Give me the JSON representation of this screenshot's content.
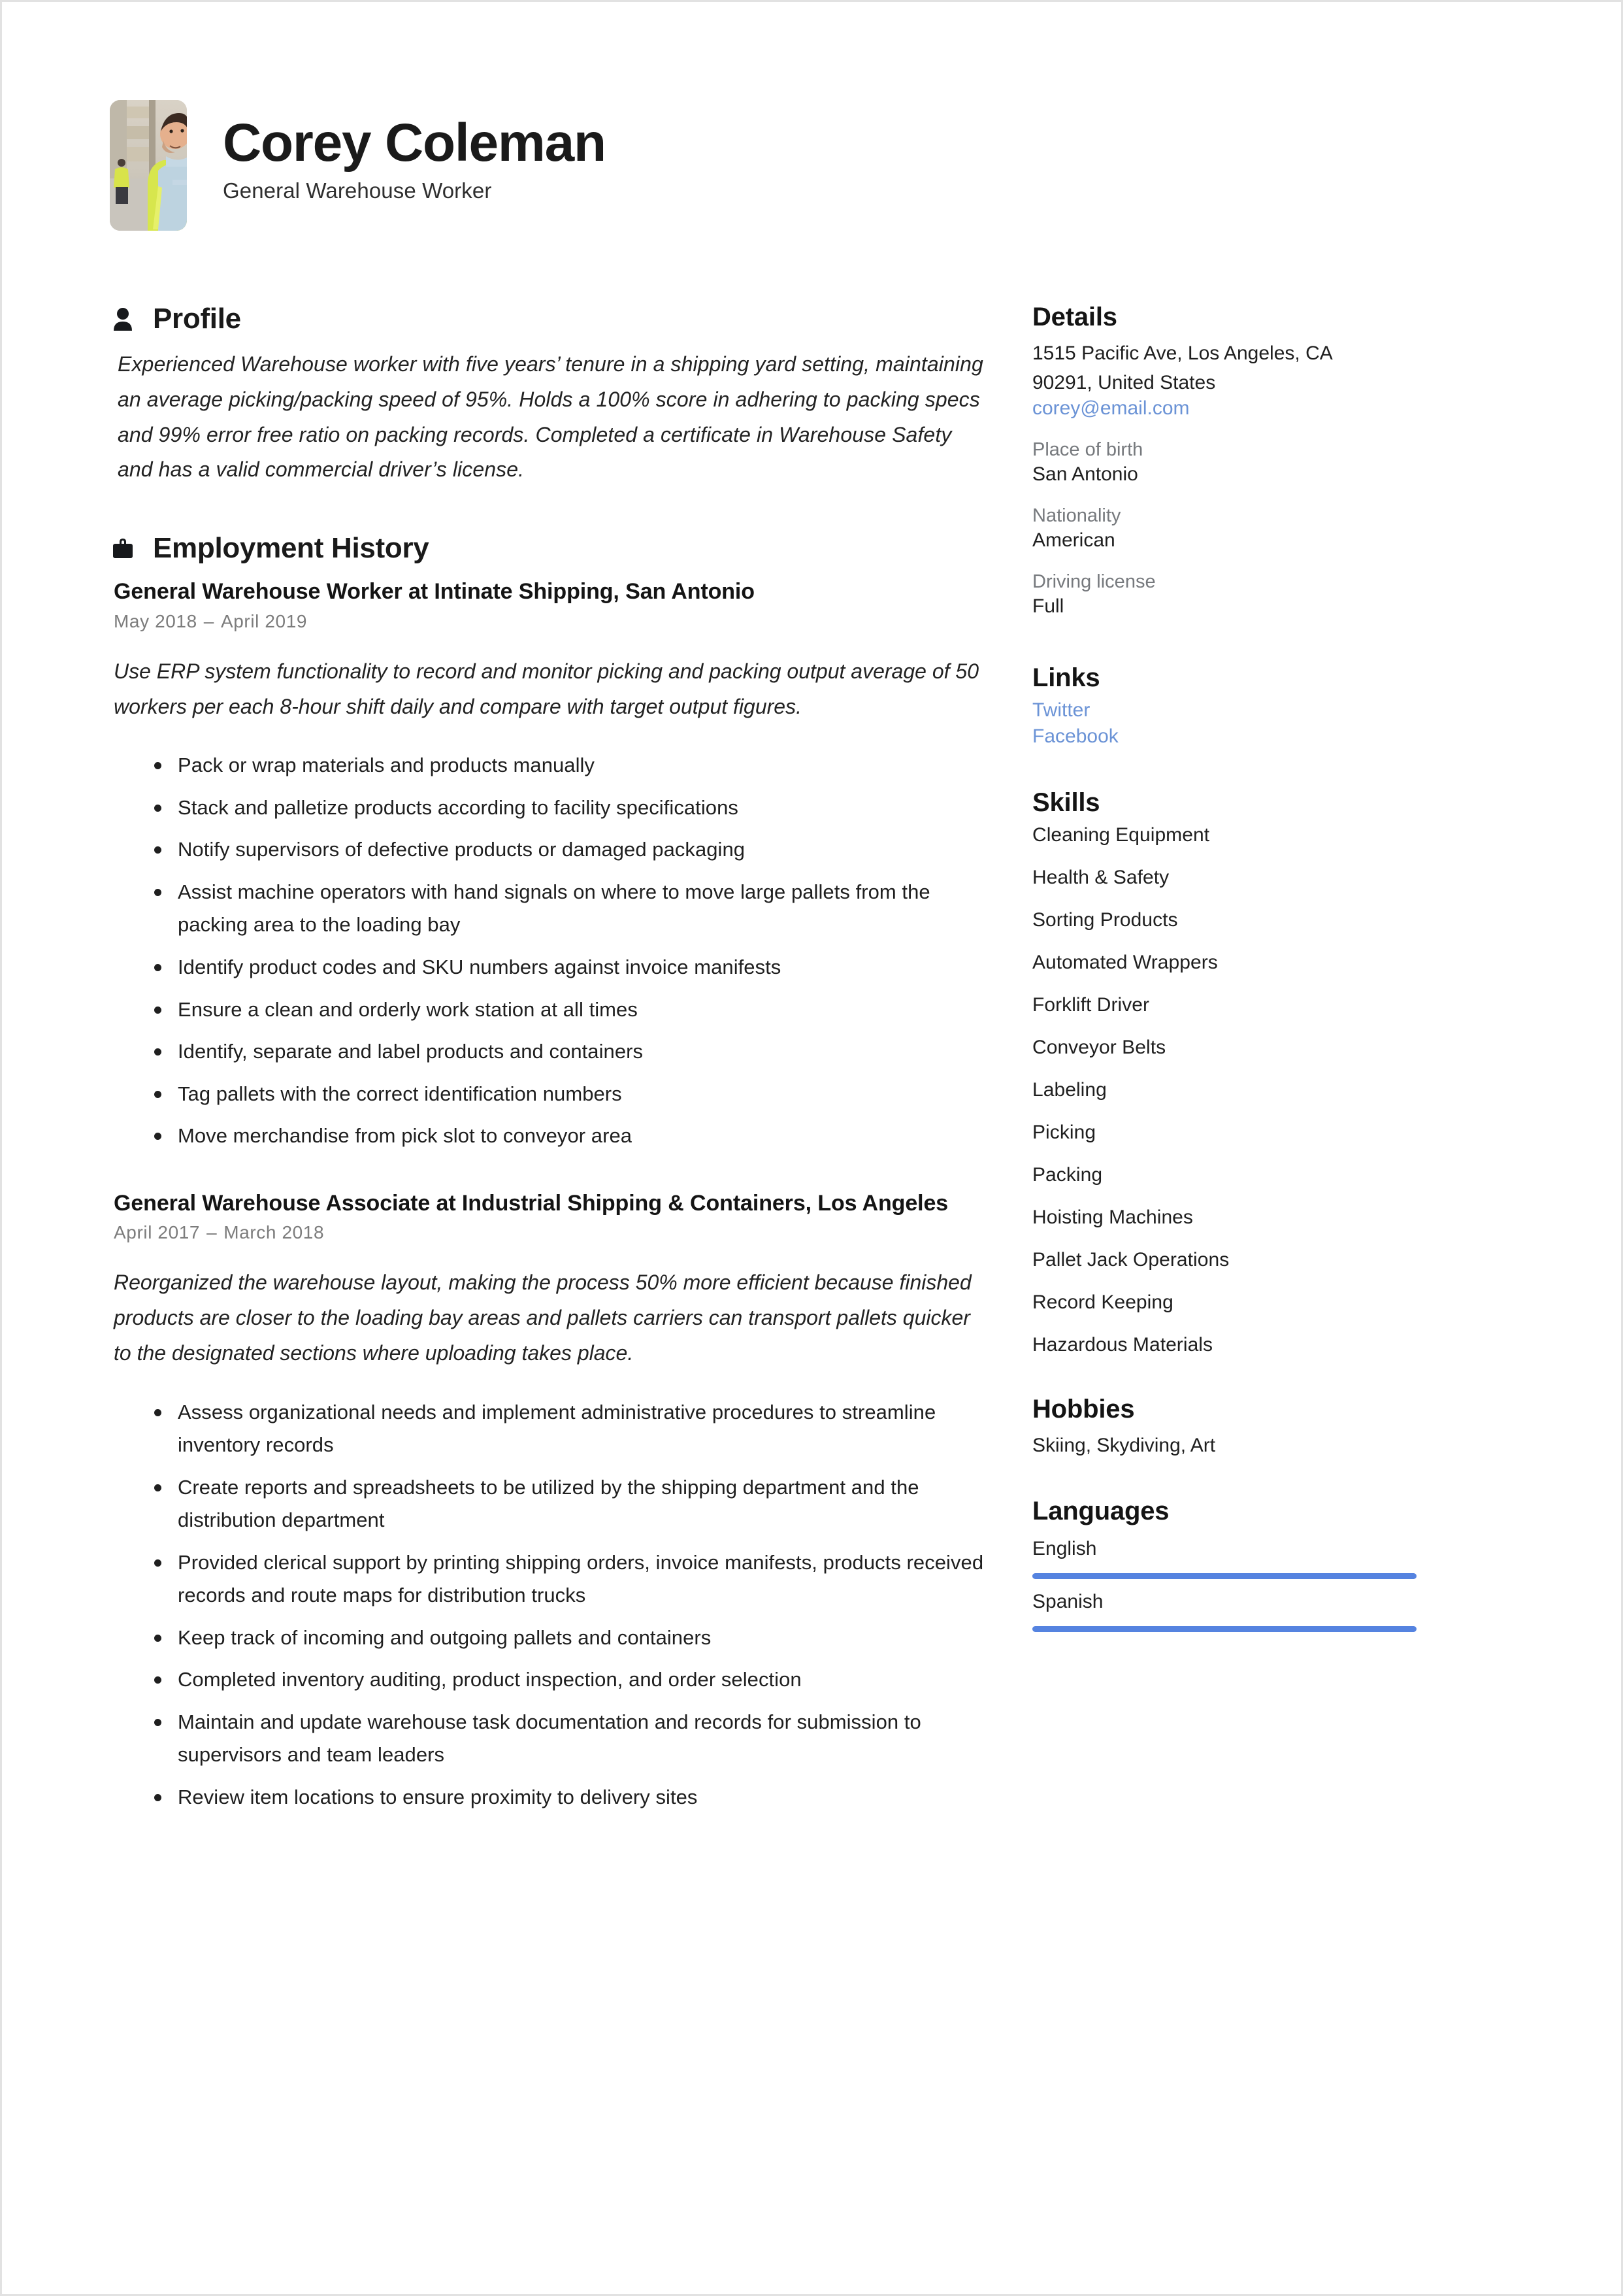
{
  "theme": {
    "accent": "#5583e0",
    "link": "#6b93d6",
    "text": "#1f1f1f",
    "muted": "#76797d",
    "border": "#e2e2e2"
  },
  "header": {
    "name": "Corey Coleman",
    "role": "General Warehouse Worker",
    "photo_alt": "warehouse-worker-portrait"
  },
  "main": {
    "profile": {
      "icon": "person-icon",
      "heading": "Profile",
      "text": " Experienced Warehouse worker with five years’ tenure in a shipping yard setting, maintaining an average picking/packing speed of 95%. Holds a 100% score in adhering to packing specs and 99% error free ratio on packing records. Completed a certificate in Warehouse Safety and has a valid commercial driver’s license."
    },
    "employment": {
      "icon": "briefcase-icon",
      "heading": "Employment History",
      "jobs": [
        {
          "title": "General Warehouse Worker at Intinate Shipping, San Antonio",
          "start": "May 2018",
          "dash": "–",
          "end": "April 2019",
          "description": "Use ERP system functionality to record and monitor picking and packing output average of 50 workers per each 8-hour shift daily and compare with target output figures.",
          "bullets": [
            "Pack or wrap materials and products manually",
            "Stack and palletize products according to facility specifications",
            "Notify supervisors of defective products or damaged packaging",
            "Assist machine operators with hand signals on where to move large pallets from the packing area to the loading bay",
            "Identify product codes and SKU numbers against invoice manifests",
            "Ensure a clean and orderly work station at all times",
            "Identify, separate and label products and containers",
            "Tag pallets with the correct identification numbers",
            "Move merchandise from pick slot to conveyor area"
          ]
        },
        {
          "title": "General Warehouse Associate at Industrial Shipping & Containers, Los Angeles",
          "start": "April 2017",
          "dash": "–",
          "end": "March 2018",
          "description": "Reorganized the warehouse layout, making the process 50% more efficient because finished products are closer to the loading bay areas and pallets carriers can transport pallets quicker to the designated sections where uploading takes place.",
          "bullets": [
            "Assess organizational needs and implement administrative procedures to streamline inventory records",
            "Create reports and spreadsheets to be utilized by the shipping department and the distribution department",
            "Provided clerical support by printing shipping orders, invoice manifests, products received records and route maps for distribution trucks",
            "Keep track of incoming and outgoing pallets and containers",
            "Completed inventory auditing, product inspection, and order selection",
            "Maintain and update warehouse task documentation and records for submission to supervisors and team leaders",
            "Review item locations to ensure proximity to delivery sites"
          ]
        }
      ]
    }
  },
  "sidebar": {
    "details": {
      "heading": "Details",
      "address_line1": "1515 Pacific Ave, Los Angeles, CA",
      "address_line2": "90291, United States",
      "email": "corey@email.com",
      "fields": [
        {
          "label": "Place of birth",
          "value": "San Antonio"
        },
        {
          "label": "Nationality",
          "value": "American"
        },
        {
          "label": "Driving license",
          "value": "Full"
        }
      ]
    },
    "links": {
      "heading": "Links",
      "items": [
        {
          "label": "Twitter"
        },
        {
          "label": "Facebook"
        }
      ]
    },
    "skills": {
      "heading": "Skills",
      "items": [
        "Cleaning Equipment",
        "Health & Safety",
        "Sorting Products",
        "Automated Wrappers",
        "Forklift Driver",
        "Conveyor Belts",
        "Labeling",
        "Picking",
        "Packing",
        "Hoisting Machines",
        "Pallet Jack Operations",
        "Record Keeping",
        "Hazardous Materials"
      ]
    },
    "hobbies": {
      "heading": "Hobbies",
      "text": "Skiing, Skydiving, Art"
    },
    "languages": {
      "heading": "Languages",
      "items": [
        {
          "name": "English",
          "level_percent": 100
        },
        {
          "name": "Spanish",
          "level_percent": 100
        }
      ]
    }
  }
}
